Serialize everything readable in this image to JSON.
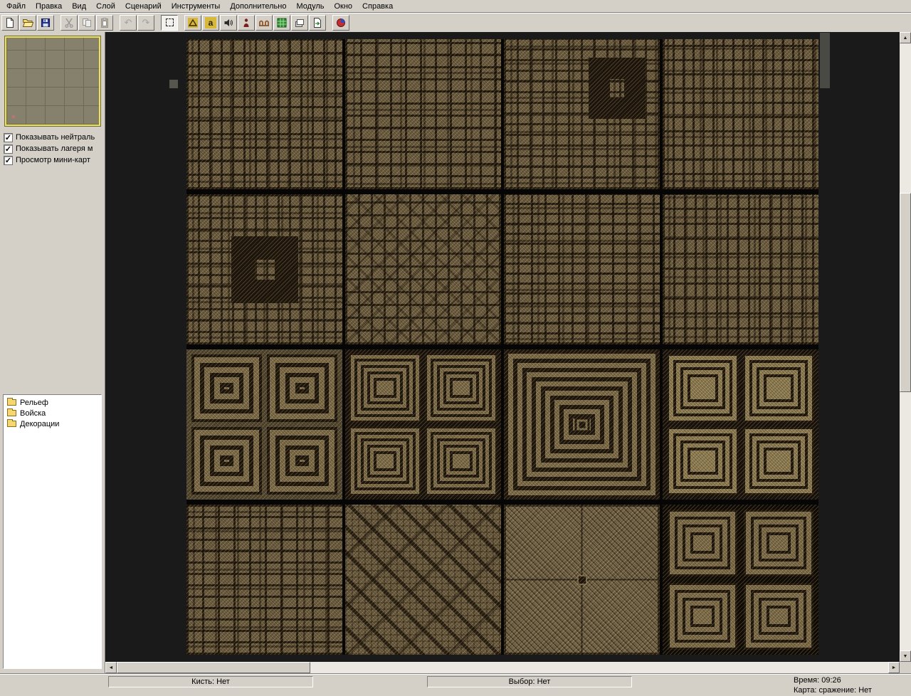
{
  "menu": {
    "items": [
      "Файл",
      "Правка",
      "Вид",
      "Слой",
      "Сценарий",
      "Инструменты",
      "Дополнительно",
      "Модуль",
      "Окно",
      "Справка"
    ]
  },
  "toolbar": {
    "buttons": [
      {
        "name": "new-file-button",
        "icon": "blank-page"
      },
      {
        "name": "open-button",
        "icon": "open-folder"
      },
      {
        "name": "save-button",
        "icon": "floppy-disk"
      },
      {
        "name": "cut-button",
        "icon": "scissors",
        "disabled": true
      },
      {
        "name": "copy-button",
        "icon": "copy-pages",
        "disabled": true
      },
      {
        "name": "paste-button",
        "icon": "clipboard",
        "disabled": true
      },
      {
        "name": "undo-button",
        "icon": "undo-arrow",
        "glyph": "↶",
        "disabled": true
      },
      {
        "name": "redo-button",
        "icon": "redo-arrow",
        "glyph": "↷",
        "disabled": true
      },
      {
        "name": "select-rect-button",
        "icon": "selection-marquee",
        "active": true
      },
      {
        "name": "terrain-button",
        "icon": "terrain-triangle"
      },
      {
        "name": "text-button",
        "icon": "letter-a",
        "glyph": "a"
      },
      {
        "name": "sound-button",
        "icon": "speaker"
      },
      {
        "name": "units-button",
        "icon": "unit-figure"
      },
      {
        "name": "bridge-button",
        "icon": "bridge"
      },
      {
        "name": "grid-button",
        "icon": "green-grid"
      },
      {
        "name": "layers-button",
        "icon": "layers"
      },
      {
        "name": "export-button",
        "icon": "page-export"
      },
      {
        "name": "module-button",
        "icon": "module"
      }
    ]
  },
  "sidebar": {
    "minimap": {
      "marker_glyph": "×"
    },
    "check_glyph": "✓",
    "checkboxes": [
      {
        "label": "Показывать нейтраль",
        "checked": true
      },
      {
        "label": "Показывать лагеря м",
        "checked": true
      },
      {
        "label": "Просмотр мини-карт",
        "checked": true
      }
    ],
    "tree": {
      "items": [
        {
          "label": "Рельеф"
        },
        {
          "label": "Войска"
        },
        {
          "label": "Декорации"
        }
      ]
    }
  },
  "canvas": {
    "grid_rows": 4,
    "grid_cols": 4,
    "tile_patterns": [
      [
        "maze",
        "maze",
        "maze-with-spiral",
        "maze"
      ],
      [
        "maze-with-ring",
        "maze-diamond",
        "maze",
        "maze"
      ],
      [
        "greek-quadrants",
        "quad-concentric",
        "concentric-labyrinth",
        "quad-spiral"
      ],
      [
        "maze",
        "diagonal-steps",
        "fine-hatch-center",
        "quad-concentric-gapped"
      ]
    ]
  },
  "scrollbars": {
    "up": "▲",
    "down": "▼",
    "left": "◄",
    "right": "►"
  },
  "statusbar": {
    "brush": "Кисть: Нет",
    "selection": "Выбор: Нет",
    "time": "Время: 09:26",
    "map": "Карта: сражение: Нет"
  },
  "colors": {
    "chrome": "#d4d0c8",
    "canvas_bg": "#1a1a1a",
    "tile_light": "#7c6b48",
    "tile_dark": "#1d150a",
    "minimap_bg": "#85816d",
    "minimap_grid": "#6d6959",
    "minimap_border": "#f0e24a",
    "folder": "#f5d76e",
    "marker": "#e06880"
  }
}
